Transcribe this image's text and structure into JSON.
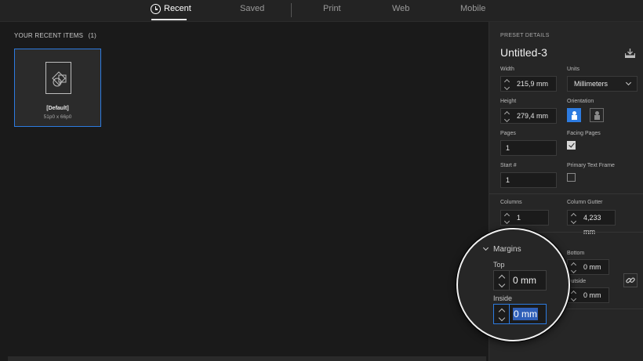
{
  "tabs": [
    {
      "label": "Recent",
      "active": true
    },
    {
      "label": "Saved",
      "active": false
    },
    {
      "label": "Print",
      "active": false
    },
    {
      "label": "Web",
      "active": false
    },
    {
      "label": "Mobile",
      "active": false
    }
  ],
  "recent": {
    "section_title": "YOUR RECENT ITEMS",
    "count": "(1)",
    "items": [
      {
        "name": "[Default]",
        "size": "51p0 x 66p0",
        "icon": "document-shapes-icon"
      }
    ]
  },
  "panel": {
    "heading": "PRESET DETAILS",
    "title": "Untitled-3",
    "width_label": "Width",
    "width_value": "215,9 mm",
    "units_label": "Units",
    "units_value": "Millimeters",
    "height_label": "Height",
    "height_value": "279,4 mm",
    "orientation_label": "Orientation",
    "pages_label": "Pages",
    "pages_value": "1",
    "facing_label": "Facing Pages",
    "facing_checked": true,
    "start_label": "Start #",
    "start_value": "1",
    "ptf_label": "Primary Text Frame",
    "ptf_checked": false,
    "columns_label": "Columns",
    "columns_value": "1",
    "gutter_label": "Column Gutter",
    "gutter_value": "4,233 mm",
    "bottom_label": "Bottom",
    "bottom_value": "0 mm",
    "outside_label": "Outside",
    "outside_value": "0 mm"
  },
  "magnifier": {
    "heading": "Margins",
    "top_label": "Top",
    "top_value": "0 mm",
    "inside_label": "Inside",
    "inside_value": "0 mm"
  },
  "colors": {
    "accent": "#2d7be0",
    "background": "#1a1a1a",
    "panel": "#262626"
  }
}
